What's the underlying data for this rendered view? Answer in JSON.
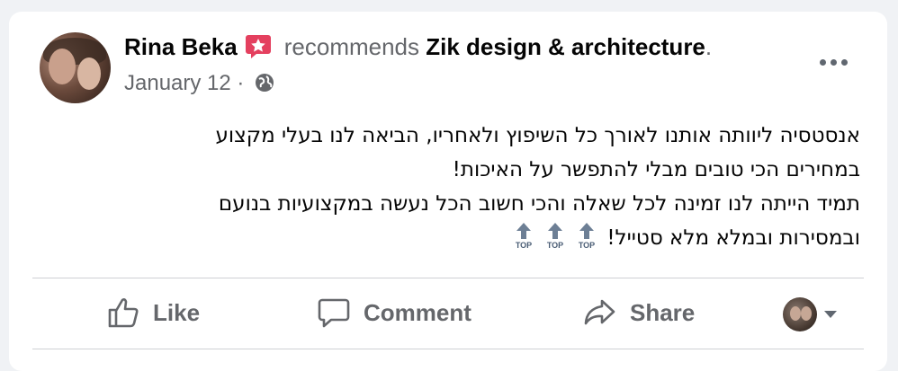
{
  "post": {
    "author": "Rina Beka",
    "action_verb": "recommends",
    "page_name": "Zik design & architecture",
    "page_name_suffix": ".",
    "date": "January 12 ·",
    "privacy_icon": "globe-icon",
    "recommend_badge_icon": "recommendation-star-icon",
    "text_lines": [
      "אנסטסיה ליוותה אותנו לאורך כל השיפוץ ולאחריו, הביאה לנו בעלי מקצוע",
      "במחירים הכי טובים מבלי להתפשר על האיכות!",
      "תמיד הייתה לנו זמינה לכל שאלה והכי חשוב הכל נעשה במקצועיות בנועם",
      "ובמסירות ובמלא מלא סטייל!"
    ],
    "emoji_icon_label": "TOP",
    "emoji_count": 3
  },
  "actions": {
    "like_label": "Like",
    "comment_label": "Comment",
    "share_label": "Share"
  },
  "colors": {
    "text": "#050505",
    "secondary": "#65676b",
    "badge": "#e4405f",
    "divider": "#ced0d4"
  }
}
